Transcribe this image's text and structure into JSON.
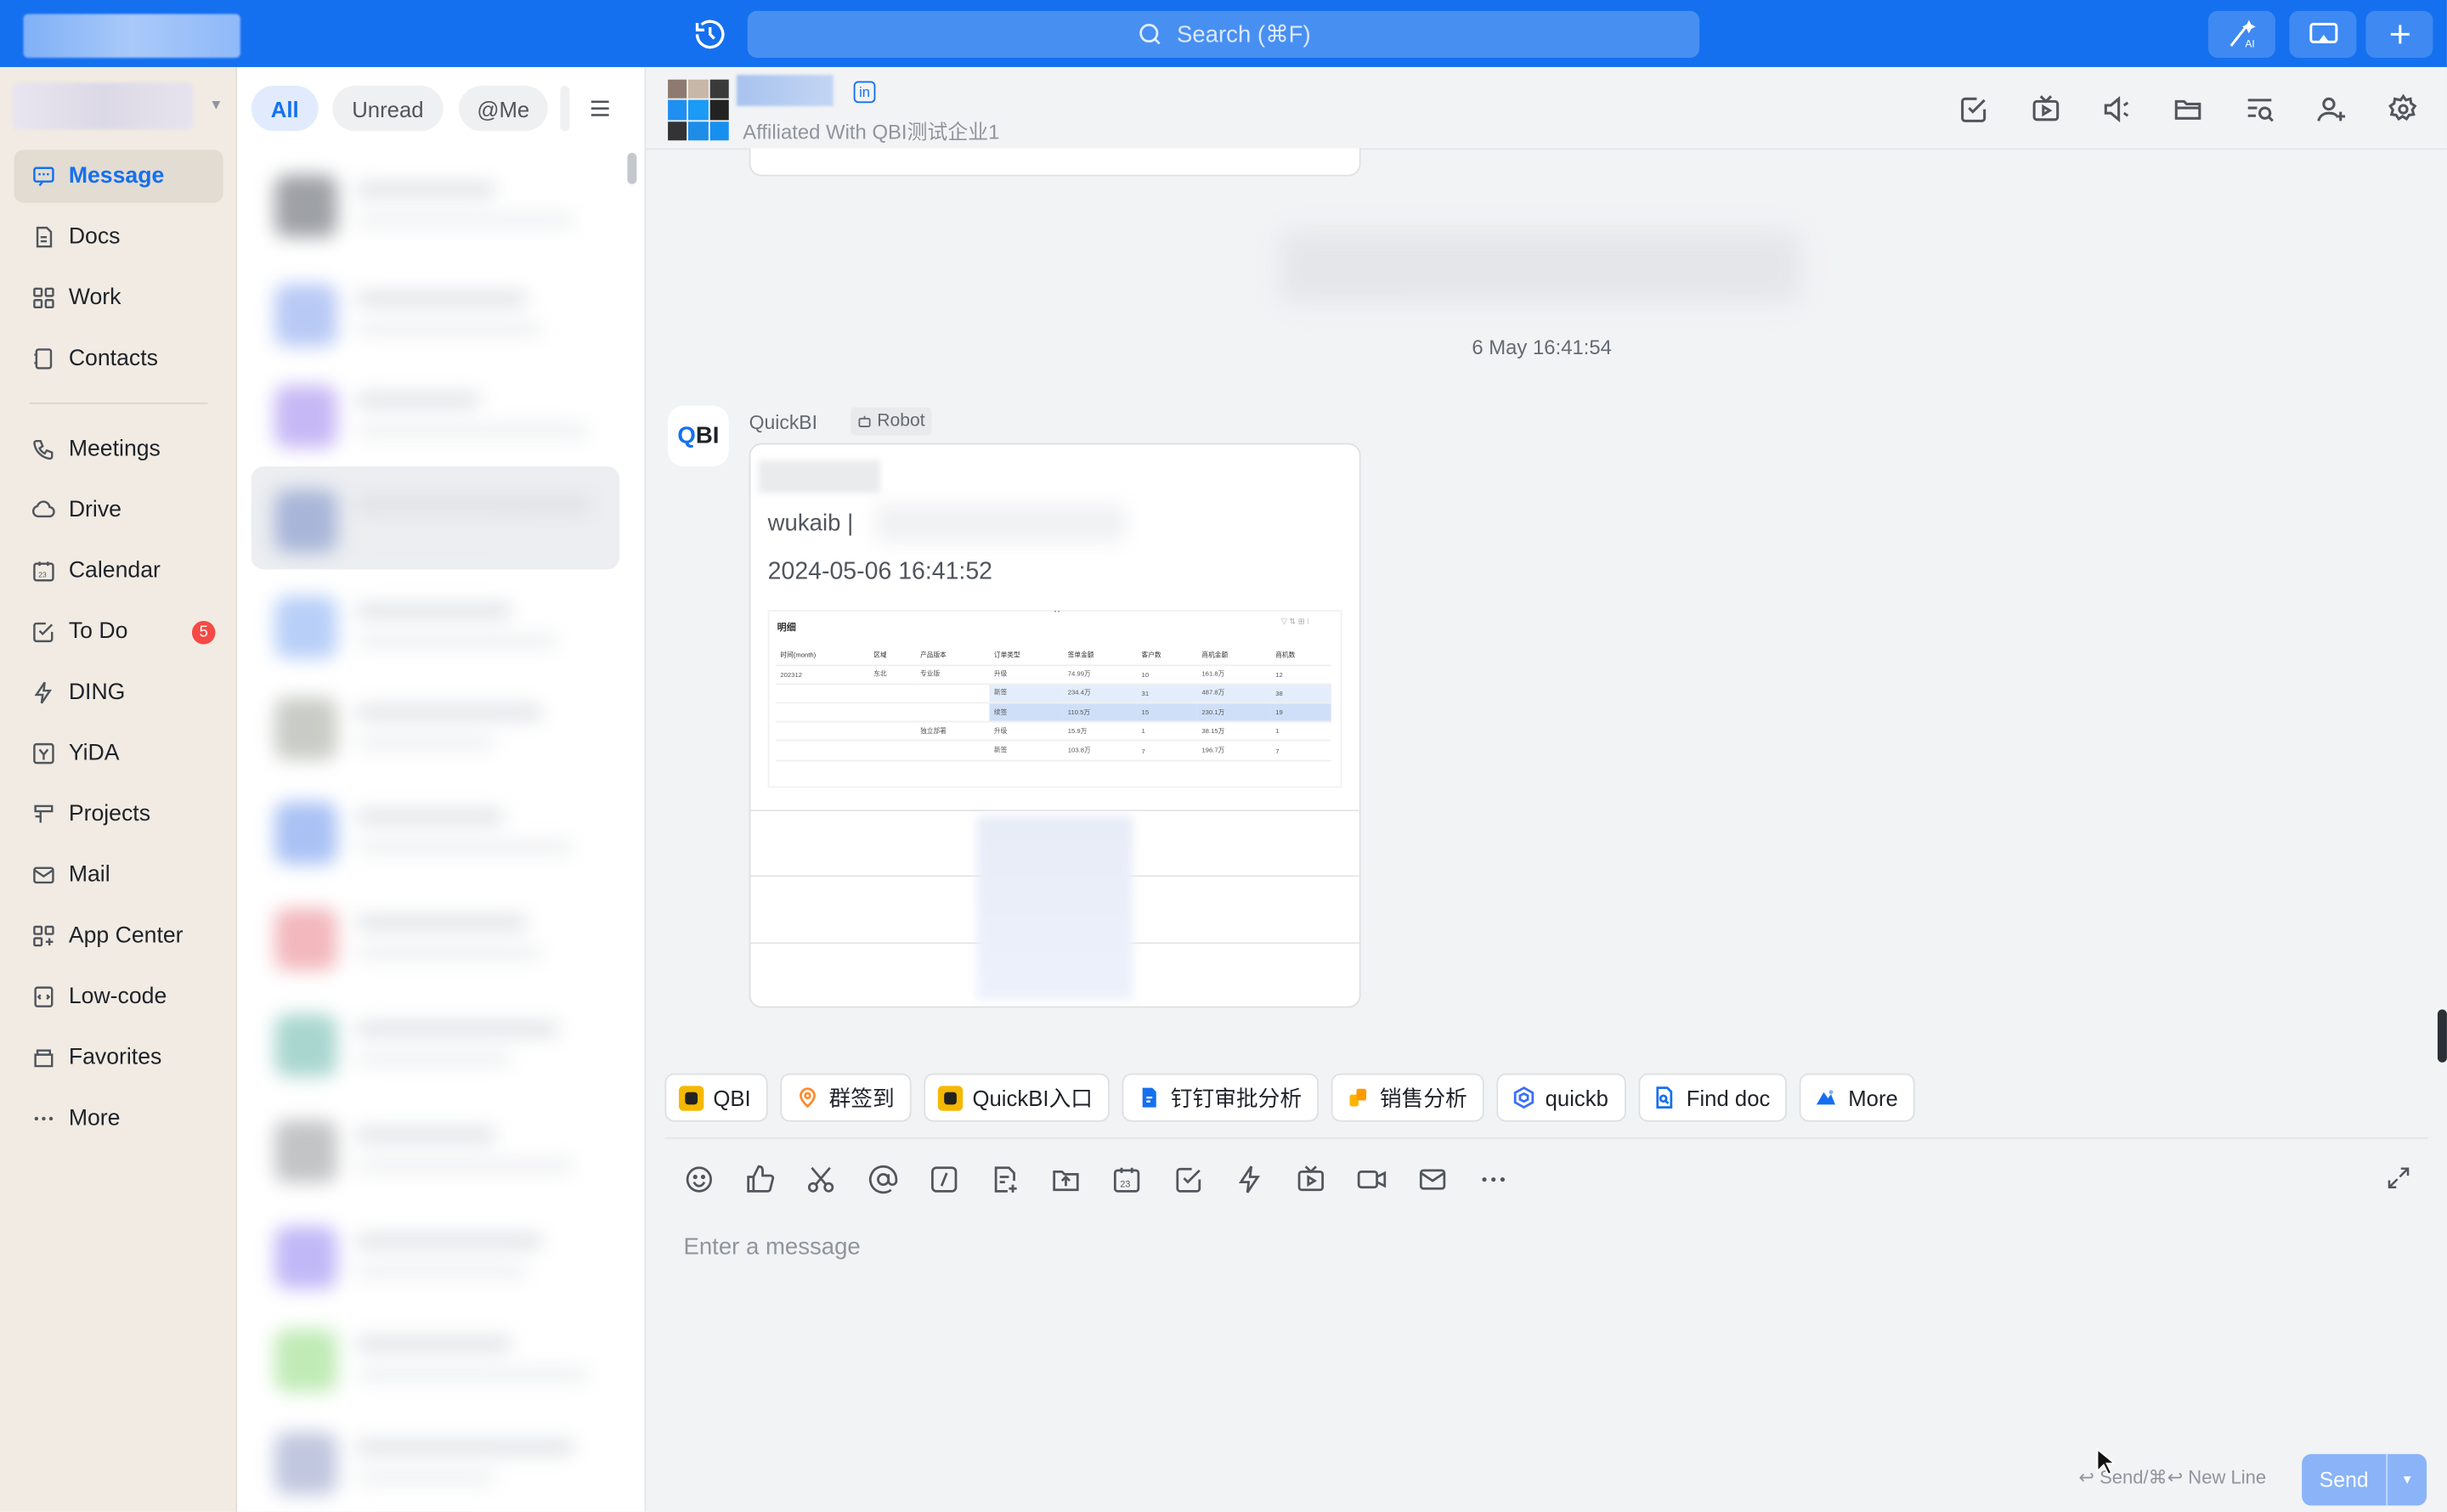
{
  "topbar": {
    "search_placeholder": "Search (⌘F)",
    "icons": [
      "history-icon",
      "search-icon",
      "ai-wand-icon",
      "screen-share-icon",
      "plus-icon"
    ]
  },
  "sidebar": {
    "items": [
      {
        "label": "Message",
        "icon": "message-icon",
        "active": true
      },
      {
        "label": "Docs",
        "icon": "docs-icon"
      },
      {
        "label": "Work",
        "icon": "work-grid-icon"
      },
      {
        "label": "Contacts",
        "icon": "contacts-icon"
      },
      {
        "label": "Meetings",
        "icon": "meetings-phone-icon"
      },
      {
        "label": "Drive",
        "icon": "drive-cloud-icon"
      },
      {
        "label": "Calendar",
        "icon": "calendar-icon"
      },
      {
        "label": "To Do",
        "icon": "todo-check-icon",
        "badge": "5"
      },
      {
        "label": "DING",
        "icon": "ding-lightning-icon"
      },
      {
        "label": "YiDA",
        "icon": "yida-icon"
      },
      {
        "label": "Projects",
        "icon": "projects-icon"
      },
      {
        "label": "Mail",
        "icon": "mail-icon"
      },
      {
        "label": "App Center",
        "icon": "app-center-icon"
      },
      {
        "label": "Low-code",
        "icon": "low-code-icon"
      },
      {
        "label": "Favorites",
        "icon": "favorites-icon"
      },
      {
        "label": "More",
        "icon": "more-dots-icon"
      }
    ]
  },
  "chatlist": {
    "filters": [
      "All",
      "Unread",
      "@Me"
    ]
  },
  "chat": {
    "affiliation": "Affiliated With QBI测试企业1",
    "in_tag": "in",
    "timestamp": "6 May 16:41:54",
    "message": {
      "avatar_text_a": "Q",
      "avatar_text_b": "BI",
      "sender": "QuickBI",
      "robot_tag": "Robot",
      "user": "wukaib |",
      "time": "2024-05-06 16:41:52",
      "thumb": {
        "title": "明细",
        "headers": [
          "时间(month)",
          "区域",
          "产品版本",
          "订单类型",
          "签单金额",
          "客户数",
          "商机金额",
          "商机数"
        ],
        "rows": [
          [
            "202312",
            "东北",
            "专业版",
            "升级",
            "74.99万",
            "10",
            "161.8万",
            "12"
          ],
          [
            "",
            "",
            "",
            "新签",
            "234.4万",
            "31",
            "487.8万",
            "38"
          ],
          [
            "",
            "",
            "",
            "续签",
            "110.5万",
            "15",
            "230.1万",
            "19"
          ],
          [
            "",
            "",
            "独立部署",
            "升级",
            "15.9万",
            "1",
            "38.15万",
            "1"
          ],
          [
            "",
            "",
            "",
            "新签",
            "103.8万",
            "7",
            "196.7万",
            "7"
          ]
        ]
      }
    },
    "quick_actions": [
      {
        "label": "QBI",
        "icon": "qbi-app-icon",
        "color": "#f5b800"
      },
      {
        "label": "群签到",
        "icon": "checkin-location-icon",
        "color": "#ff8a2b"
      },
      {
        "label": "QuickBI入口",
        "icon": "quickbi-entry-icon",
        "color": "#f5b800"
      },
      {
        "label": "钉钉审批分析",
        "icon": "approval-analysis-icon",
        "color": "#1570ef"
      },
      {
        "label": "销售分析",
        "icon": "sales-analysis-icon",
        "color": "#ffb300"
      },
      {
        "label": "quickb",
        "icon": "quickb-hex-icon",
        "color": "#3b6ef5"
      },
      {
        "label": "Find doc",
        "icon": "find-doc-icon",
        "color": "#1570ef"
      },
      {
        "label": "More",
        "icon": "more-apps-icon",
        "color": "#1570ef"
      }
    ],
    "input_placeholder": "Enter a message",
    "send_hint": "↩ Send/⌘↩ New Line",
    "send_label": "Send"
  },
  "colors": {
    "primary": "#1570ef",
    "nav_bg": "#f1ebe3",
    "badge": "#f54a45"
  }
}
